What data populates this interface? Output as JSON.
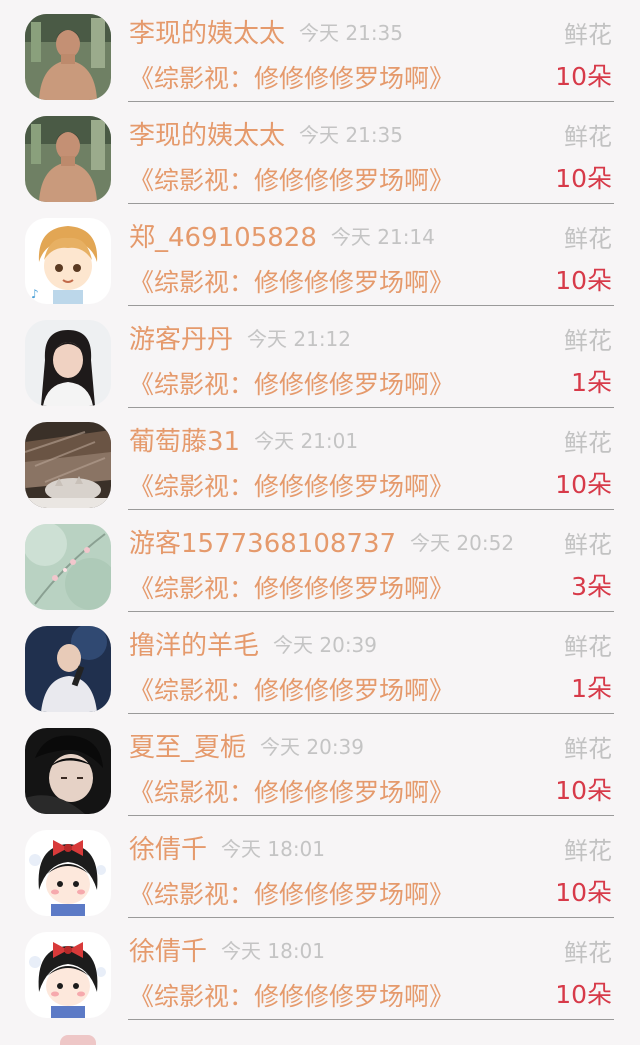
{
  "items": [
    {
      "name": "李现的姨太太",
      "time": "今天 21:35",
      "type": "鲜花",
      "book": "《综影视：修修修修罗场啊》",
      "count": "10朵",
      "avatar": "shirtless-man-avatar"
    },
    {
      "name": "李现的姨太太",
      "time": "今天 21:35",
      "type": "鲜花",
      "book": "《综影视：修修修修罗场啊》",
      "count": "10朵",
      "avatar": "shirtless-man-avatar"
    },
    {
      "name": "郑_469105828",
      "time": "今天 21:14",
      "type": "鲜花",
      "book": "《综影视：修修修修罗场啊》",
      "count": "10朵",
      "avatar": "cartoon-boy-avatar"
    },
    {
      "name": "游客丹丹",
      "time": "今天 21:12",
      "type": "鲜花",
      "book": "《综影视：修修修修罗场啊》",
      "count": "1朵",
      "avatar": "woman-photo-avatar"
    },
    {
      "name": "葡萄藤31",
      "time": "今天 21:01",
      "type": "鲜花",
      "book": "《综影视：修修修修罗场啊》",
      "count": "10朵",
      "avatar": "cat-blanket-avatar"
    },
    {
      "name": "游客1577368108737",
      "time": "今天 20:52",
      "type": "鲜花",
      "book": "《综影视：修修修修罗场啊》",
      "count": "3朵",
      "avatar": "blossom-avatar"
    },
    {
      "name": "撸洋的羊毛",
      "time": "今天 20:39",
      "type": "鲜花",
      "book": "《综影视：修修修修罗场啊》",
      "count": "1朵",
      "avatar": "singer-avatar"
    },
    {
      "name": "夏至_夏栀",
      "time": "今天 20:39",
      "type": "鲜花",
      "book": "《综影视：修修修修罗场啊》",
      "count": "10朵",
      "avatar": "portrait-man-avatar"
    },
    {
      "name": "徐倩千",
      "time": "今天 18:01",
      "type": "鲜花",
      "book": "《综影视：修修修修罗场啊》",
      "count": "10朵",
      "avatar": "cartoon-girl-avatar"
    },
    {
      "name": "徐倩千",
      "time": "今天 18:01",
      "type": "鲜花",
      "book": "《综影视：修修修修罗场啊》",
      "count": "10朵",
      "avatar": "cartoon-girl-avatar"
    }
  ],
  "colors": {
    "name": "#e59a6c",
    "time": "#c4c4c4",
    "type": "#c2c2c2",
    "count": "#d73a49",
    "background": "#f7f5f6"
  }
}
